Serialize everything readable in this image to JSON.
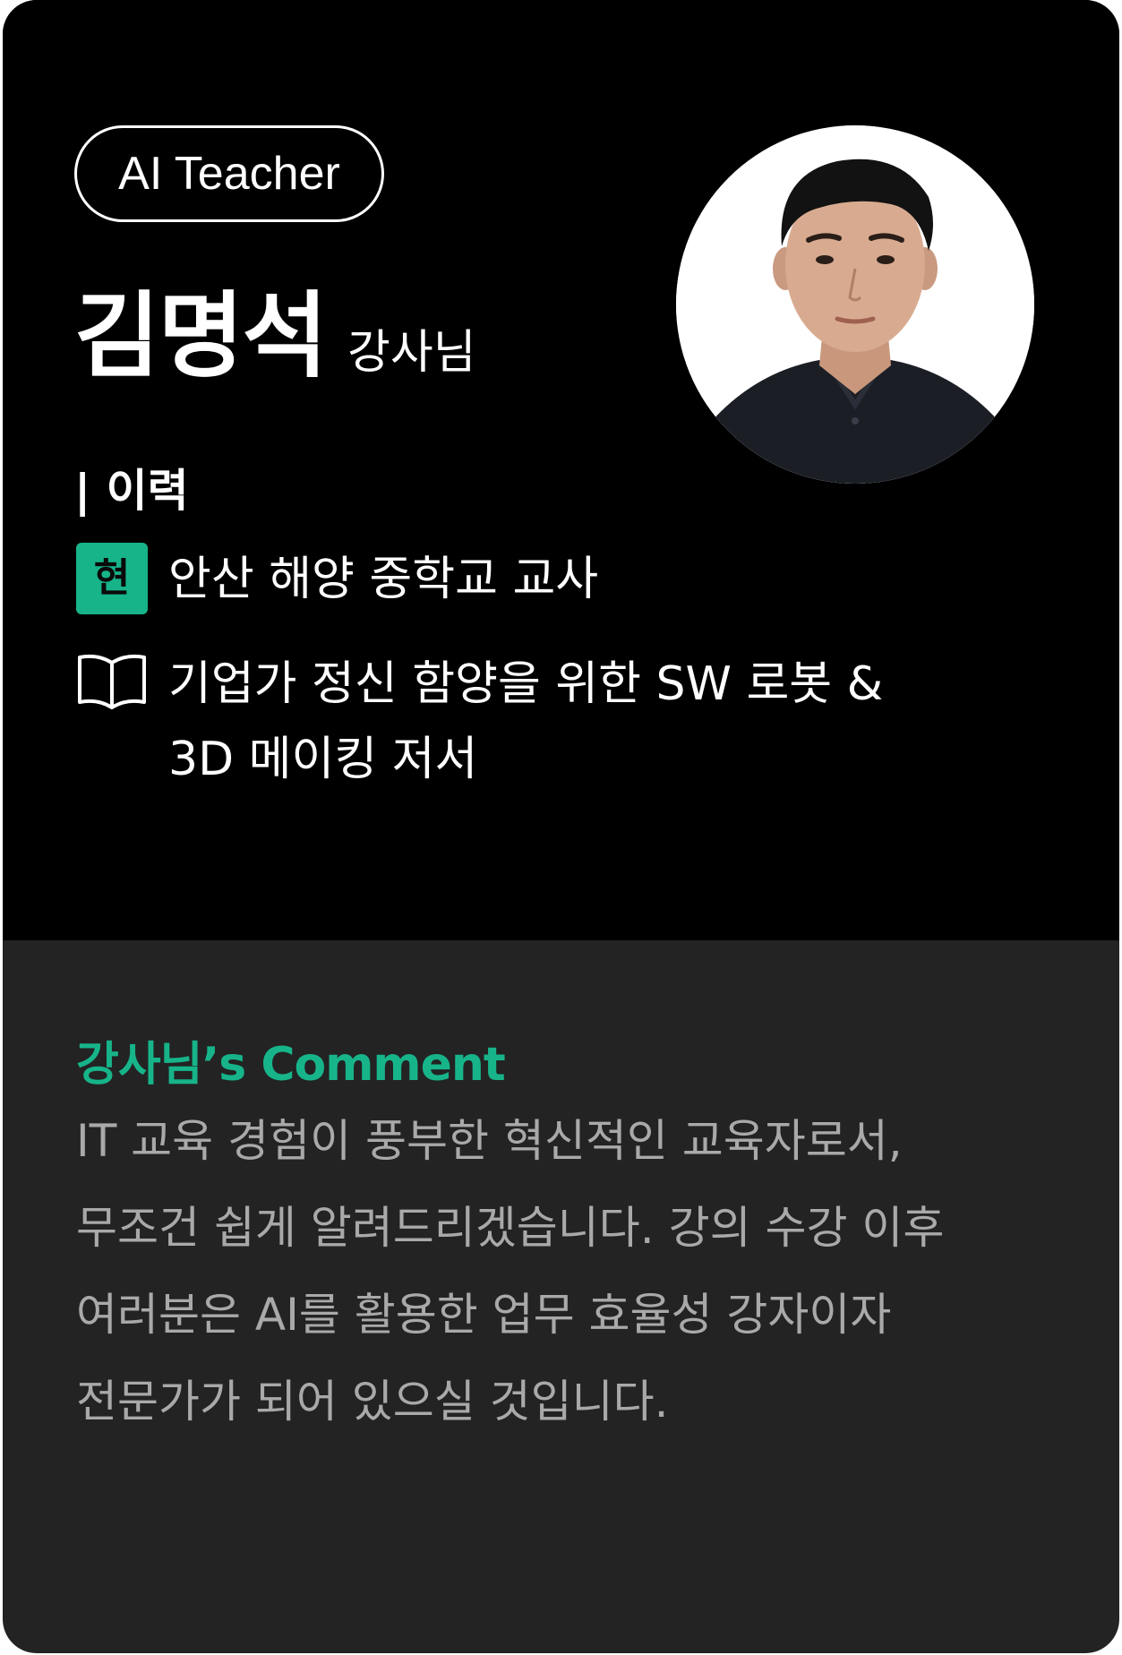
{
  "badge": "AI Teacher",
  "teacher": {
    "name": "김명석",
    "honorific": "강사님"
  },
  "career": {
    "section_label": "| 이력",
    "current_tag": "현",
    "current_position": "안산 해양 중학교 교사",
    "book_line1": "기업가 정신 함양을 위한 SW 로봇 &",
    "book_line2": "3D 메이킹 저서"
  },
  "comment": {
    "title": "강사님’s Comment",
    "lines": [
      "IT 교육 경험이 풍부한 혁신적인 교육자로서,",
      "무조건 쉽게 알려드리겠습니다. 강의 수강 이후",
      "여러분은 AI를 활용한 업무 효율성 강자이자",
      "전문가가 되어 있으실 것입니다."
    ]
  },
  "colors": {
    "accent": "#17b48a",
    "top_bg": "#000000",
    "bottom_bg": "#232323",
    "comment_text": "#a9a9a9"
  },
  "icons": {
    "book": "open-book-icon"
  }
}
